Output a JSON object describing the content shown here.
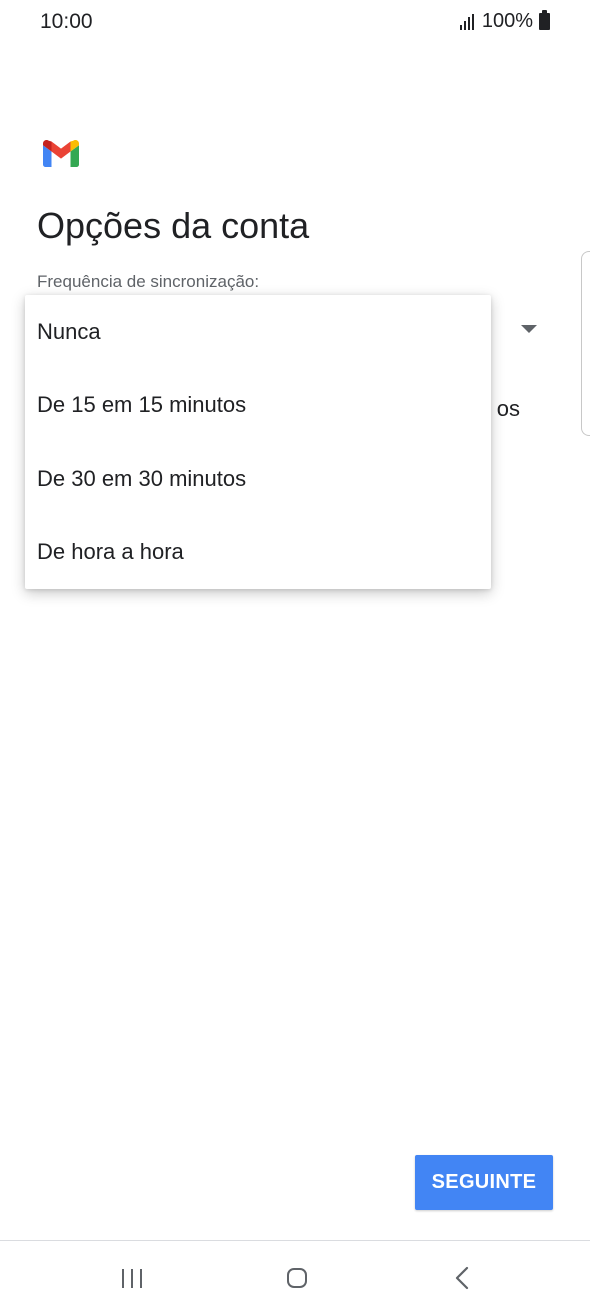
{
  "status_bar": {
    "time": "10:00",
    "battery_percent": "100%",
    "icons": [
      "signal-icon",
      "battery-icon"
    ]
  },
  "app": {
    "logo": "gmail-logo",
    "brand_colors": {
      "blue": "#4285F4",
      "red": "#EA4335",
      "yellow": "#FBBC04",
      "green": "#34A853",
      "dark_red": "#C5221F"
    }
  },
  "page": {
    "title": "Opções da conta",
    "sync_label": "Frequência de sincronização:"
  },
  "sync_select": {
    "partial_visible_text": "os",
    "options": [
      "Nunca",
      "De 15 em 15 minutos",
      "De 30 em 30 minutos",
      "De hora a hora"
    ]
  },
  "actions": {
    "next_label": "SEGUINTE",
    "next_color": "#4285F4"
  },
  "nav_bar": {
    "icons": [
      "recents-icon",
      "home-icon",
      "back-icon"
    ]
  }
}
